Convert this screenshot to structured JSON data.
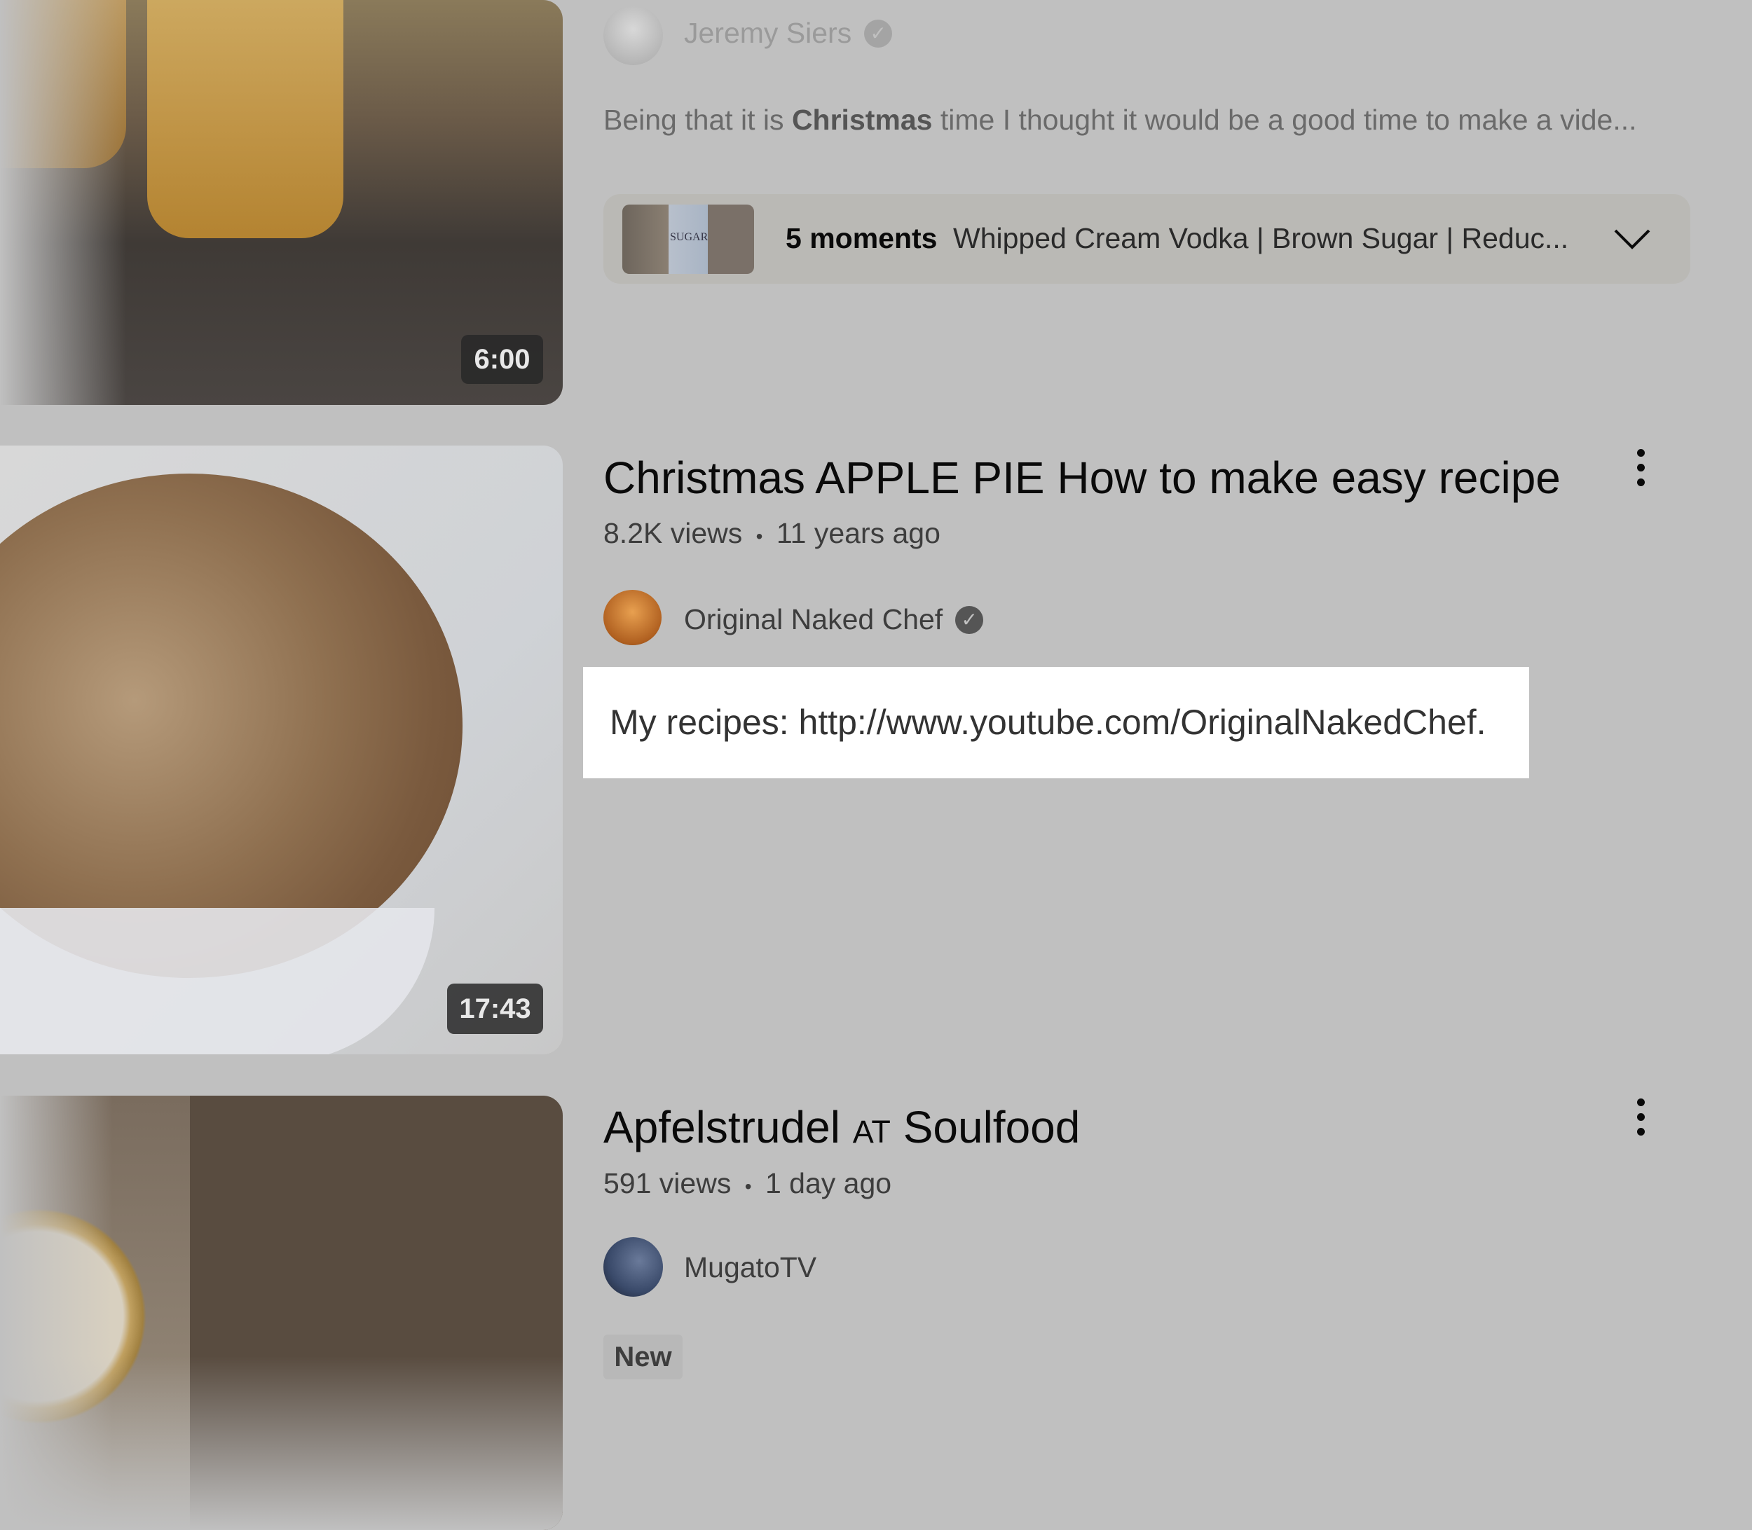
{
  "videos": [
    {
      "duration": "6:00",
      "channel": "Jeremy Siers",
      "verified": true,
      "description_parts": [
        "Being that it is ",
        "Christmas",
        " time I thought it would be a good time to make a vide..."
      ],
      "moments": {
        "count_label": "5 moments",
        "text": "Whipped Cream Vodka | Brown Sugar | Reduc...",
        "thumb_text": "SUGAR"
      }
    },
    {
      "duration": "17:43",
      "title": "Christmas APPLE PIE How to make easy recipe",
      "views": "8.2K views",
      "age": "11 years ago",
      "channel": "Original Naked Chef",
      "verified": true,
      "description": "My recipes: http://www.youtube.com/OriginalNakedChef."
    },
    {
      "title_parts": [
        "Apfelstrudel ",
        "at",
        " Soulfood"
      ],
      "views": "591 views",
      "age": "1 day ago",
      "channel": "MugatoTV",
      "badge": "New"
    }
  ],
  "separator": "•",
  "colors": {
    "overlay_bg": "#c0c0c0",
    "highlight_bg": "#ffffff",
    "thumb3_brown": "#594c40"
  }
}
